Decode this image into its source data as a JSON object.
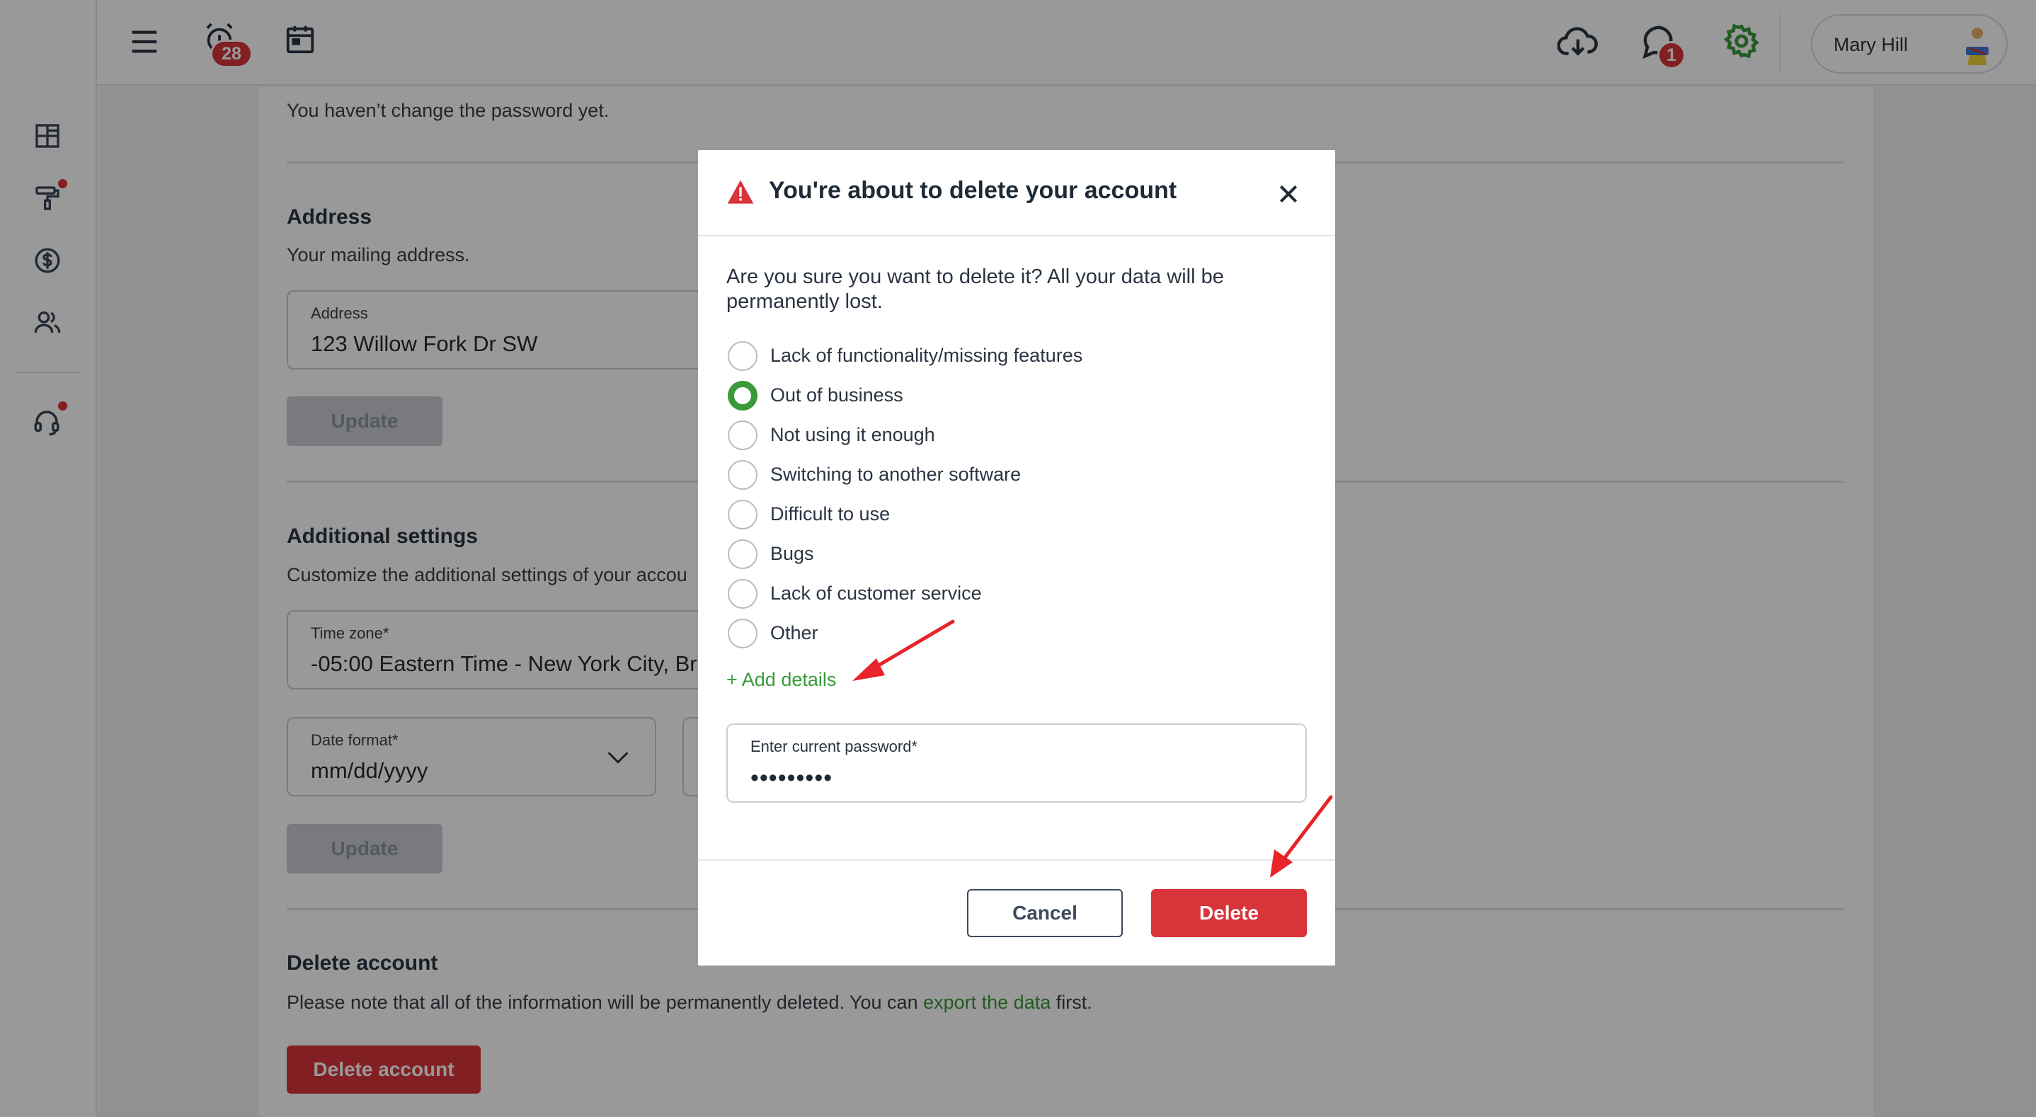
{
  "colors": {
    "accent_green": "#3a9a3a",
    "danger_red": "#d9343a",
    "overlay": "rgba(0,0,0,0.40)"
  },
  "sidebar": {
    "items": [
      {
        "icon": "dashboard-icon"
      },
      {
        "icon": "paint-roller-icon",
        "has_dot": true
      },
      {
        "icon": "dollar-circle-icon"
      },
      {
        "icon": "users-icon"
      },
      {
        "icon": "headset-icon",
        "has_dot": true
      }
    ]
  },
  "topbar": {
    "alarm_badge": "28",
    "chat_badge": "1",
    "user_name": "Mary Hill"
  },
  "page": {
    "password_note": "You haven’t change the password yet.",
    "address": {
      "title": "Address",
      "subtitle": "Your mailing address.",
      "field_label": "Address",
      "field_value": "123 Willow Fork Dr SW",
      "update_label": "Update"
    },
    "additional": {
      "title": "Additional settings",
      "subtitle": "Customize the additional settings of your accou",
      "timezone_label": "Time zone*",
      "timezone_value": "-05:00 Eastern Time - New York City, Br",
      "date_label": "Date format*",
      "date_value": "mm/dd/yyyy",
      "update_label": "Update"
    },
    "delete": {
      "title": "Delete account",
      "note_before": "Please note that all of the information will be permanently deleted. You can ",
      "note_link": "export the data",
      "note_after": " first.",
      "button_label": "Delete account"
    }
  },
  "modal": {
    "title": "You're about to delete your account",
    "question": "Are you sure you want to delete it? All your data will be permanently lost.",
    "reasons": [
      {
        "label": "Lack of functionality/missing features",
        "checked": false
      },
      {
        "label": "Out of business",
        "checked": true
      },
      {
        "label": "Not using it enough",
        "checked": false
      },
      {
        "label": "Switching to another software",
        "checked": false
      },
      {
        "label": "Difficult to use",
        "checked": false
      },
      {
        "label": "Bugs",
        "checked": false
      },
      {
        "label": "Lack of customer service",
        "checked": false
      },
      {
        "label": "Other",
        "checked": false
      }
    ],
    "add_details": "+ Add details",
    "password_label": "Enter current password*",
    "password_value": "•••••••••",
    "cancel_label": "Cancel",
    "delete_label": "Delete"
  }
}
